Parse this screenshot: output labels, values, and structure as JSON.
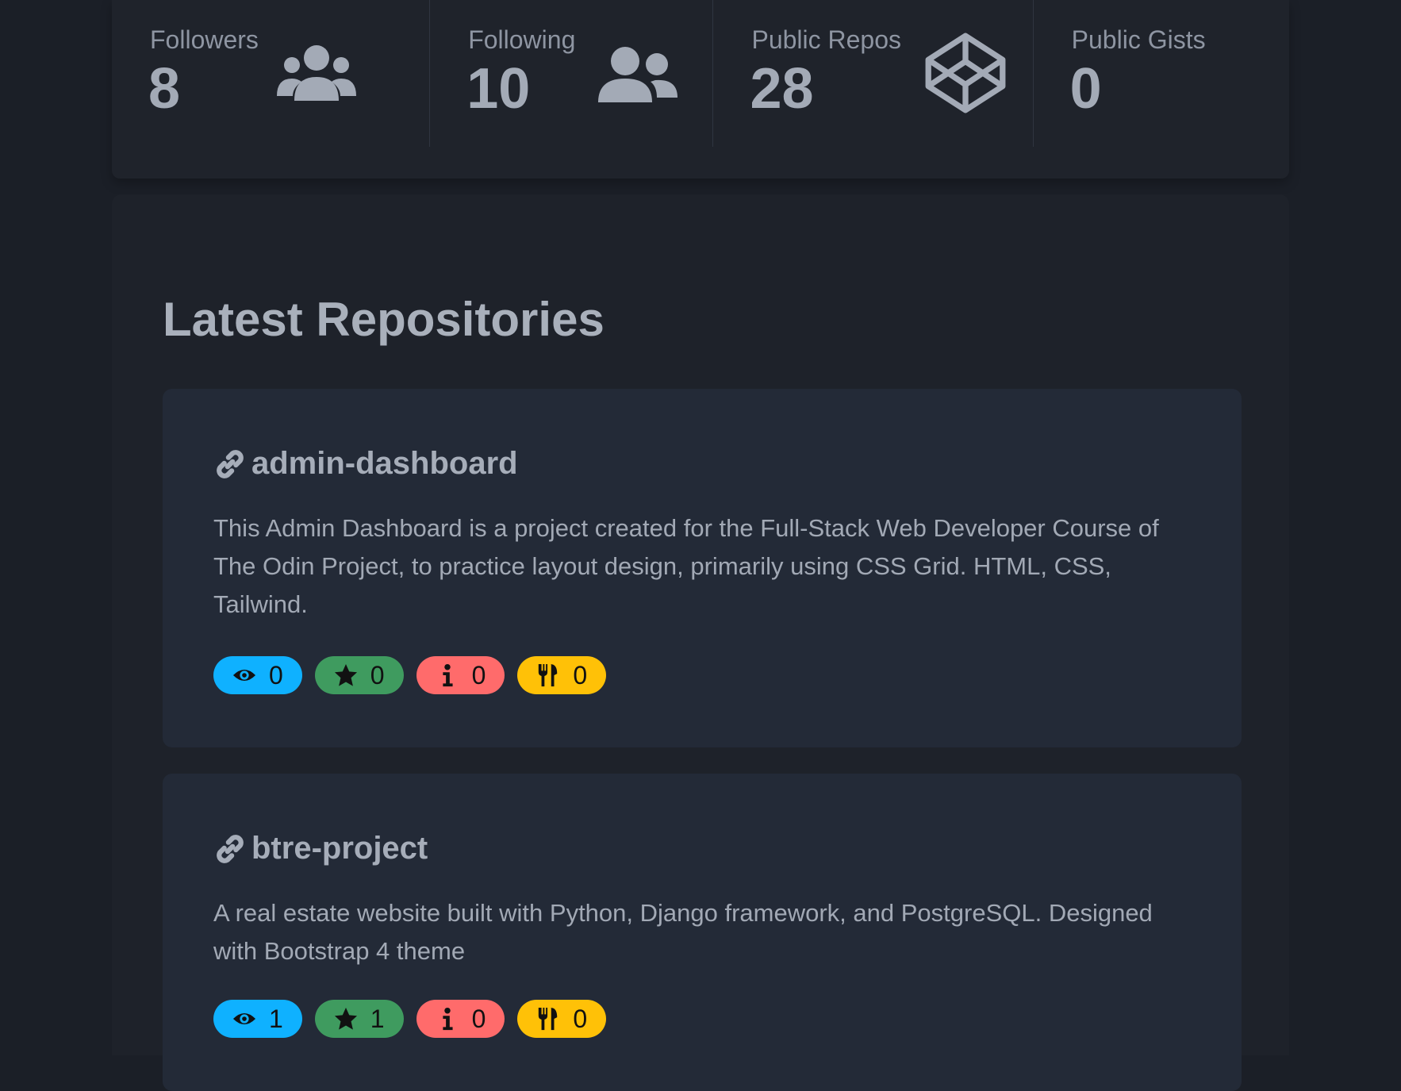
{
  "stats": [
    {
      "label": "Followers",
      "value": "8",
      "icon": "users-icon"
    },
    {
      "label": "Following",
      "value": "10",
      "icon": "user-friends-icon"
    },
    {
      "label": "Public Repos",
      "value": "28",
      "icon": "codepen-icon"
    },
    {
      "label": "Public Gists",
      "value": "0",
      "icon": ""
    }
  ],
  "section": {
    "title": "Latest Repositories"
  },
  "repos": [
    {
      "name": "admin-dashboard",
      "description": "This Admin Dashboard is a project created for the Full-Stack Web Developer Course of The Odin Project, to practice layout design, primarily using CSS Grid. HTML, CSS, Tailwind.",
      "watchers": "0",
      "stars": "0",
      "issues": "0",
      "forks": "0"
    },
    {
      "name": "btre-project",
      "description": "A real estate website built with Python, Django framework, and PostgreSQL. Designed with Bootstrap 4 theme",
      "watchers": "1",
      "stars": "1",
      "issues": "0",
      "forks": "0"
    }
  ],
  "colors": {
    "background": "#1b1f27",
    "card": "#232a37",
    "watch": "#0fb1ff",
    "star": "#3f9b5f",
    "issue": "#ff6b6b",
    "fork": "#ffc107"
  }
}
